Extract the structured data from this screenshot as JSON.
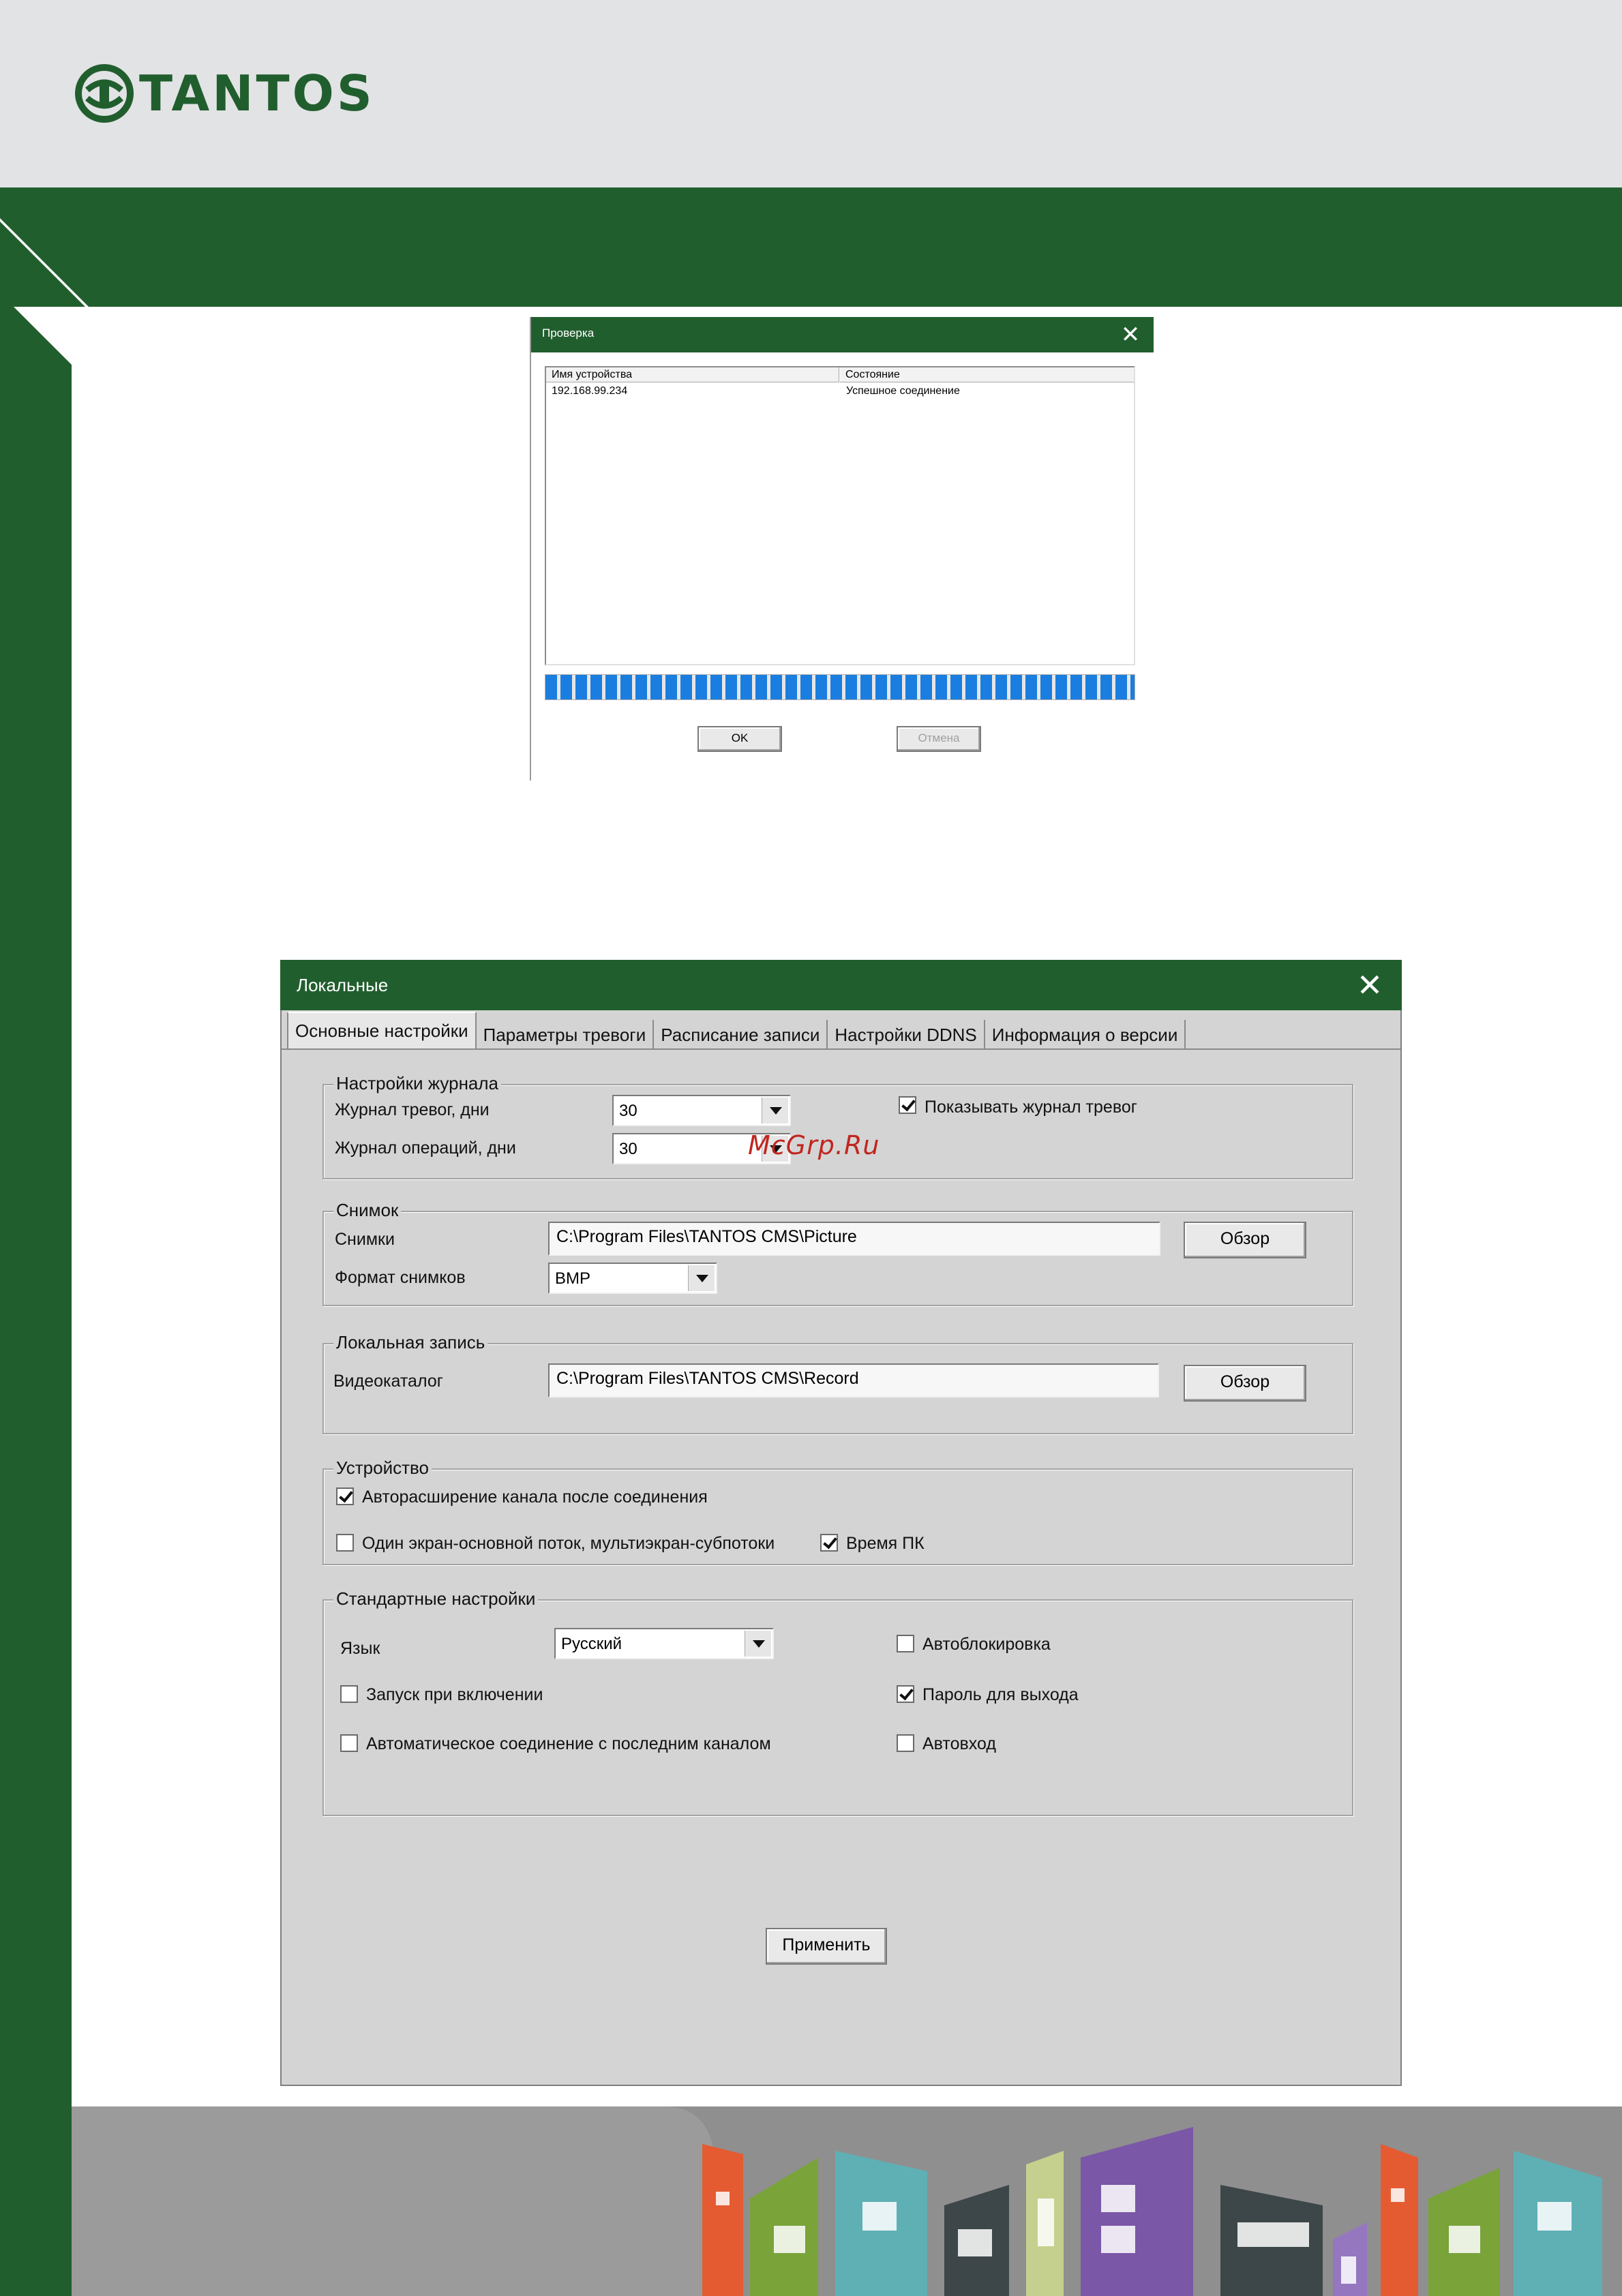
{
  "brand": {
    "name": "TANTOS",
    "color": "#215e2e"
  },
  "check_dialog": {
    "title": "Проверка",
    "columns": [
      "Имя устройства",
      "Состояние"
    ],
    "rows": [
      {
        "device": "192.168.99.234",
        "status": "Успешное соединение"
      }
    ],
    "progress_percent": 100,
    "ok_label": "OK",
    "cancel_label": "Отмена"
  },
  "settings_dialog": {
    "title": "Локальные",
    "tabs": [
      "Основные настройки",
      "Параметры тревоги",
      "Расписание записи",
      "Настройки DDNS",
      "Информация о версии"
    ],
    "log": {
      "legend": "Настройки журнала",
      "alarm_log_label": "Журнал тревог, дни",
      "alarm_log_value": "30",
      "ops_log_label": "Журнал операций, дни",
      "ops_log_value": "30",
      "show_alarm_log_label": "Показывать журнал тревог",
      "show_alarm_log_checked": true
    },
    "snapshot": {
      "legend": "Снимок",
      "path_label": "Снимки",
      "path_value": "C:\\Program Files\\TANTOS CMS\\Picture",
      "browse_label": "Обзор",
      "format_label": "Формат снимков",
      "format_value": "BMP"
    },
    "local_record": {
      "legend": "Локальная запись",
      "path_label": "Видеокаталог",
      "path_value": "C:\\Program Files\\TANTOS CMS\\Record",
      "browse_label": "Обзор"
    },
    "device": {
      "legend": "Устройство",
      "auto_expand_label": "Авторасширение канала после соединения",
      "auto_expand_checked": true,
      "stream_label": "Один экран-основной поток, мультиэкран-субпотоки",
      "stream_checked": false,
      "pc_time_label": "Время ПК",
      "pc_time_checked": true
    },
    "standard": {
      "legend": "Стандартные настройки",
      "language_label": "Язык",
      "language_value": "Русский",
      "autolock_label": "Автоблокировка",
      "autolock_checked": false,
      "startup_label": "Запуск при включении",
      "startup_checked": false,
      "exit_password_label": "Пароль для выхода",
      "exit_password_checked": true,
      "auto_connect_label": "Автоматическое соединение с последним каналом",
      "auto_connect_checked": false,
      "autologin_label": "Автовход",
      "autologin_checked": false
    },
    "apply_label": "Применить"
  },
  "watermark": "McGrp.Ru"
}
